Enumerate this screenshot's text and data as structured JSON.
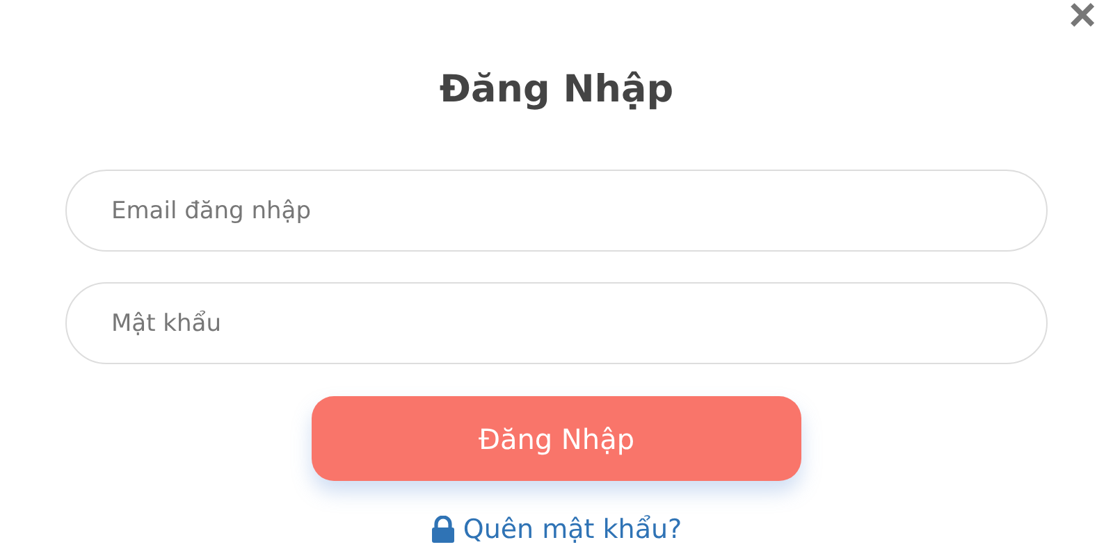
{
  "dialog": {
    "close": "×",
    "title": "Đăng Nhập"
  },
  "fields": [
    {
      "placeholder": "Email đăng nhập"
    },
    {
      "placeholder": "Mật khẩu"
    }
  ],
  "submit": "Đăng Nhập",
  "forgot_link": "Quên mật khẩu?"
}
